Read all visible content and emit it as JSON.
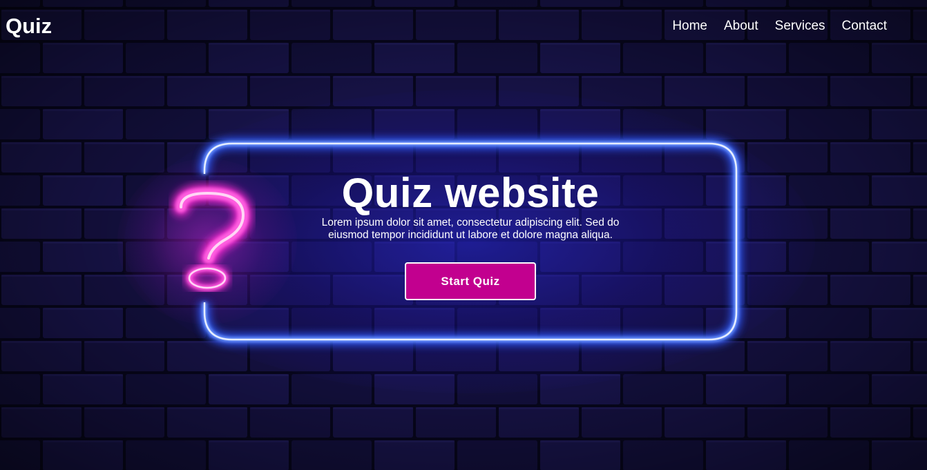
{
  "header": {
    "logo": "Quiz",
    "nav": [
      "Home",
      "About",
      "Services",
      "Contact"
    ]
  },
  "hero": {
    "title": "Quiz website",
    "description": "Lorem ipsum dolor sit amet, consectetur adipiscing elit. Sed do eiusmod tempor incididunt ut labore et dolore magna aliqua.",
    "button_label": "Start Quiz"
  },
  "colors": {
    "background": "#0c0a30",
    "neon_blue": "#4a7dff",
    "neon_pink": "#ff3bd0",
    "button": "#c2008f"
  },
  "icons": {
    "frame": "neon-frame",
    "question": "question-mark-icon"
  }
}
